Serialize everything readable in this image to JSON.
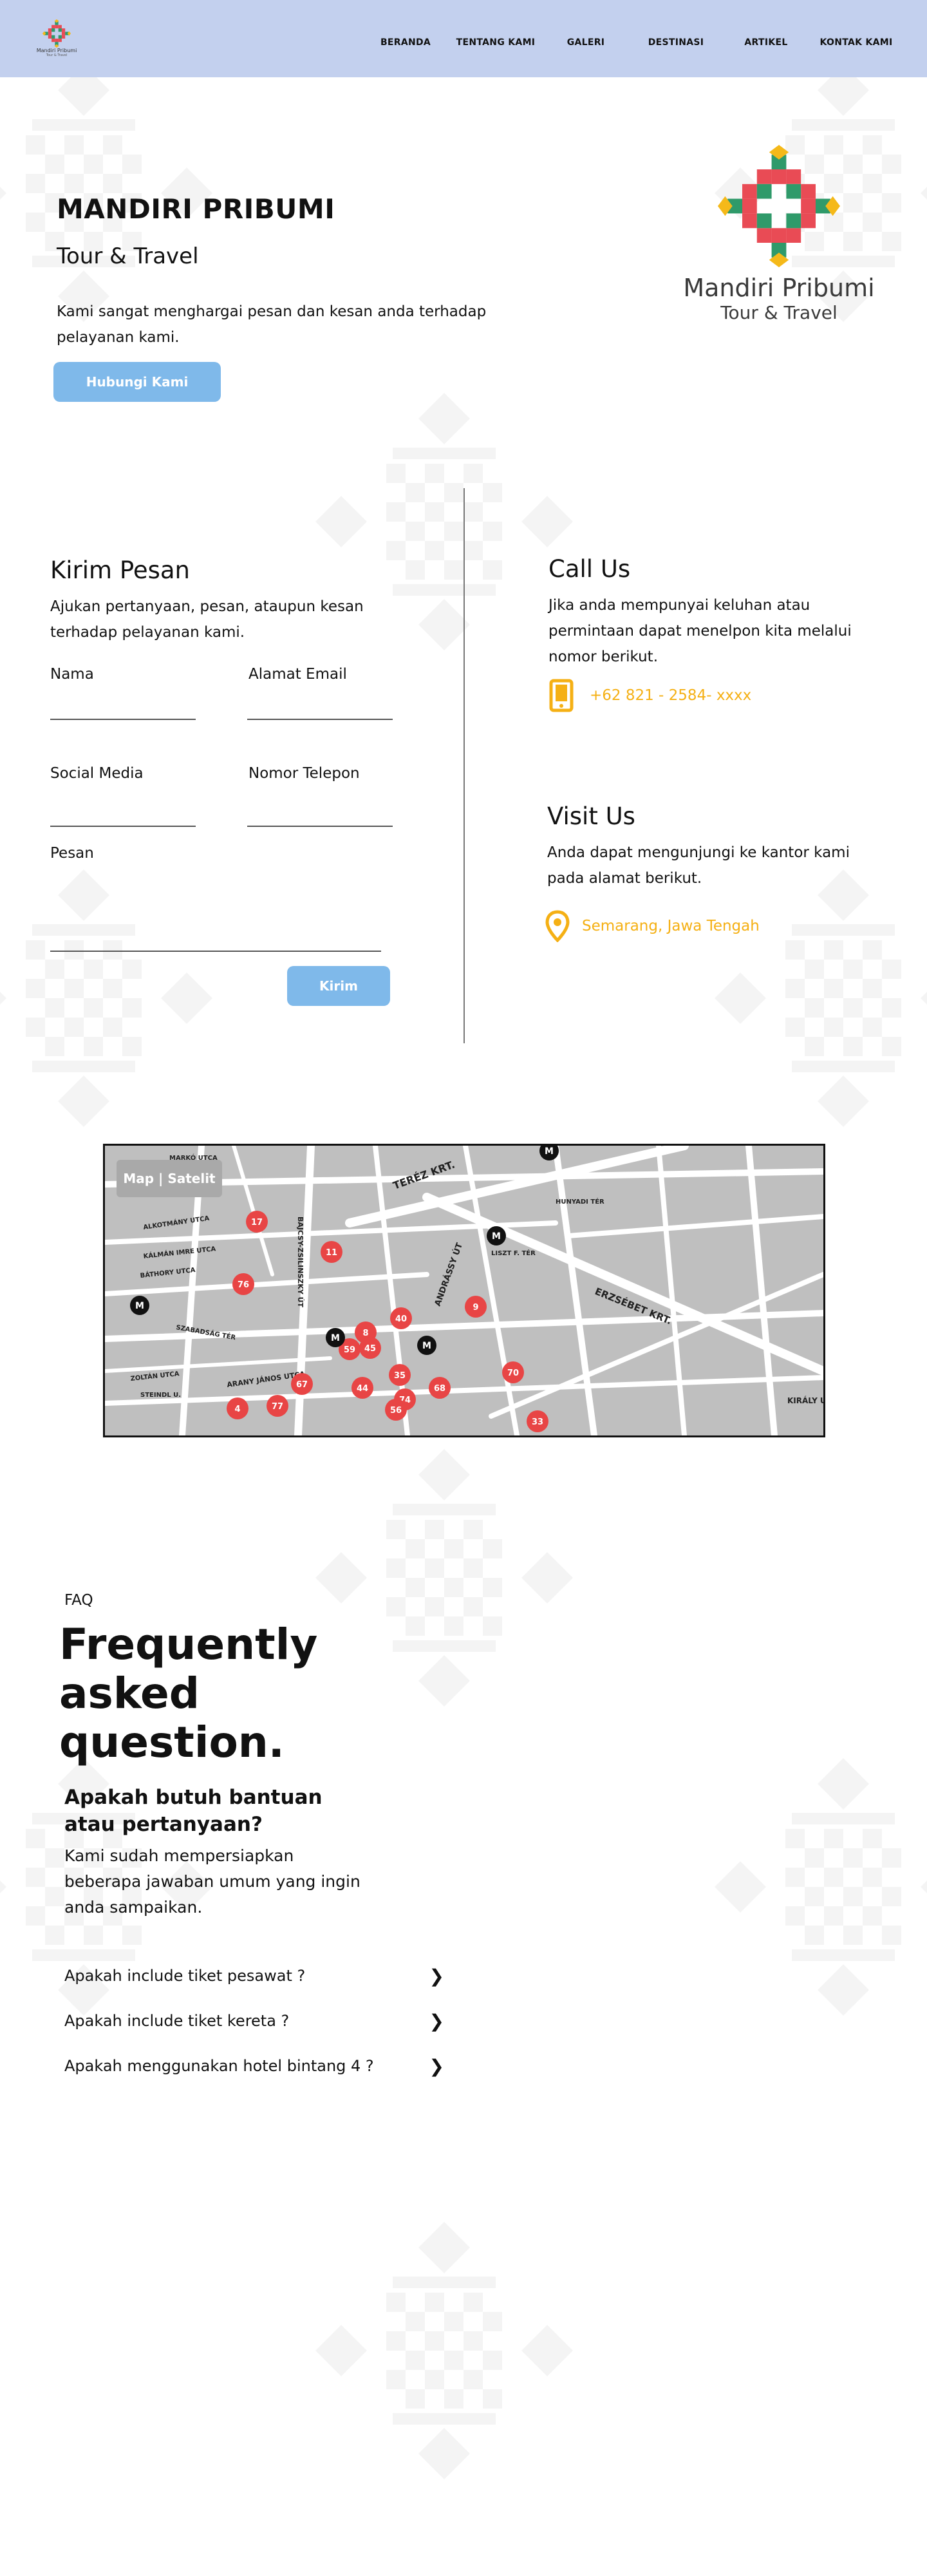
{
  "nav": {
    "logo_text": "Mandiri Pribumi",
    "logo_sub": "Tour & Travel",
    "links": [
      "BERANDA",
      "TENTANG KAMI",
      "GALERI",
      "DESTINASI",
      "ARTIKEL",
      "KONTAK KAMI"
    ]
  },
  "hero": {
    "title": "MANDIRI PRIBUMI",
    "subtitle": "Tour & Travel",
    "description": "Kami sangat menghargai pesan dan kesan anda terhadap pelayanan kami.",
    "button": "Hubungi Kami",
    "logo_brand": "Mandiri Pribumi",
    "logo_tagline": "Tour & Travel"
  },
  "form": {
    "title": "Kirim Pesan",
    "description": "Ajukan pertanyaan, pesan, ataupun kesan terhadap pelayanan kami.",
    "labels": {
      "name": "Nama",
      "email": "Alamat Email",
      "social": "Social Media",
      "phone": "Nomor Telepon",
      "message": "Pesan"
    },
    "submit": "Kirim"
  },
  "call": {
    "title": "Call Us",
    "description": "Jika anda mempunyai keluhan atau permintaan dapat menelpon kita melalui nomor berikut.",
    "phone": "+62 821 - 2584- xxxx"
  },
  "visit": {
    "title": "Visit Us",
    "description": "Anda dapat mengunjungi ke kantor kami pada alamat berikut.",
    "address": "Semarang, Jawa Tengah"
  },
  "map": {
    "toggle": "Map | Satelit",
    "streets": [
      "TERÉZ KRT.",
      "ERZSÉBET KRT.",
      "ANDRÁSSY ÚT",
      "BAJCSY-ZSILINSZKY ÚT",
      "ARANY JÁNOS UTCA",
      "SZABADSÁG TÉR",
      "KIRÁLY UTCA",
      "LISZT F. TÉR",
      "HUNYADI TÉR",
      "MARKÓ UTCA",
      "ALKOTMÁNY UTCA",
      "KÁLMÁN IMRE UTCA",
      "BÁTHORY UTCA",
      "ZOLTÁN UTCA",
      "STEINDL U."
    ],
    "markers": [
      "17",
      "11",
      "76",
      "8",
      "40",
      "59",
      "45",
      "9",
      "35",
      "44",
      "74",
      "56",
      "67",
      "68",
      "70",
      "4",
      "77",
      "33"
    ],
    "marker_color": "#e84545"
  },
  "faq": {
    "kicker": "FAQ",
    "title": "Frequently asked question.",
    "subtitle": "Apakah butuh bantuan atau pertanyaan?",
    "description": "Kami sudah mempersiapkan beberapa jawaban umum yang ingin anda sampaikan.",
    "items": [
      {
        "question": "Apakah include tiket pesawat ?",
        "icon": "chevron-right-icon"
      },
      {
        "question": "Apakah include tiket kereta ?",
        "icon": "chevron-right-icon"
      },
      {
        "question": "Apakah menggunakan hotel bintang 4 ?",
        "icon": "chevron-right-icon"
      }
    ]
  },
  "colors": {
    "navbar": "#c3d0ee",
    "button": "#7fb9ea",
    "accent": "#f5b014",
    "logo_red": "#e94b55",
    "logo_green": "#2f9a6a",
    "logo_yellow": "#f5b919"
  }
}
